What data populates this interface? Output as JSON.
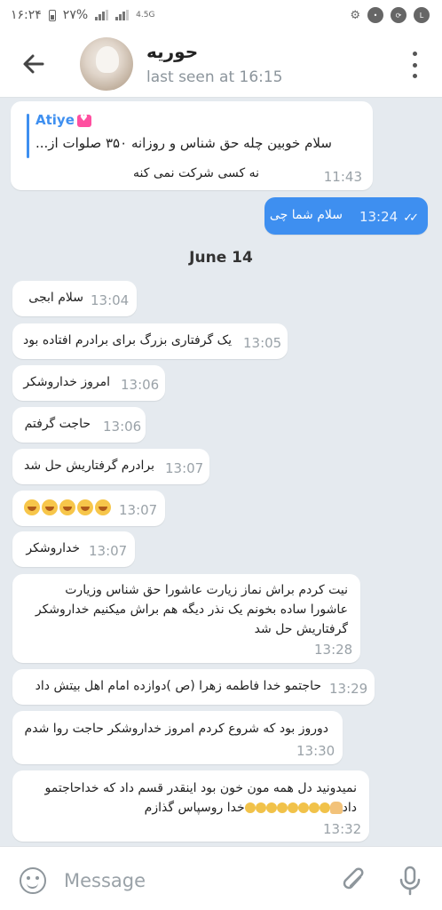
{
  "status_bar": {
    "time": "۱۶:۲۴",
    "battery": "۲۷%",
    "network": "4.5G"
  },
  "header": {
    "contact_name": "حوریه",
    "last_seen": "last seen at 16:15"
  },
  "messages": [
    {
      "direction": "in",
      "reply_to_name": "Atiye",
      "reply_to_text": "سلام خوبین چله حق شناس و روزانه ۳۵۰ صلوات از...",
      "text": "نه کسی شرکت نمی کنه",
      "time": "11:43"
    },
    {
      "direction": "out",
      "text": "سلام شما چی",
      "time": "13:24",
      "status": "read"
    }
  ],
  "date_separator": "June 14",
  "messages_day2": [
    {
      "text": "سلام ابجی",
      "time": "13:04"
    },
    {
      "text": "یک گرفتاری بزرگ برای برادرم افتاده بود",
      "time": "13:05"
    },
    {
      "text": "امروز خداروشکر",
      "time": "13:06"
    },
    {
      "text": "حاجت گرفتم",
      "time": "13:06"
    },
    {
      "text": "برادرم گرفتاریش حل شد",
      "time": "13:07"
    },
    {
      "text": "",
      "time": "13:07",
      "emoji": "crying-faces"
    },
    {
      "text": "خداروشکر",
      "time": "13:07"
    },
    {
      "line1": "نیت کردم براش نماز زیارت عاشورا حق شناس وزیارت",
      "line2": "عاشورا ساده بخونم یک نذر دیگه هم براش میکنیم خداروشکر",
      "line3": "گرفتاریش حل شد",
      "time": "13:28"
    },
    {
      "text": "حاجتمو خدا فاطمه زهرا (ص )دوازده امام اهل بیتش داد",
      "time": "13:29"
    },
    {
      "text": "دوروز بود که شروع کردم امروز خداروشکر حاجت روا شدم",
      "time": "13:30"
    },
    {
      "line1": "نمیدونید دل همه مون خون بود  اینقدر قسم داد که خداحاجتمو",
      "line2_a": "داد",
      "line2_b": "خدا روسپاس گذازم",
      "time": "13:32"
    }
  ],
  "input": {
    "placeholder": "Message"
  },
  "colors": {
    "chat_background": "#e5eaef",
    "outgoing_bubble": "#3e8ff0",
    "accent": "#3e8ff0"
  }
}
